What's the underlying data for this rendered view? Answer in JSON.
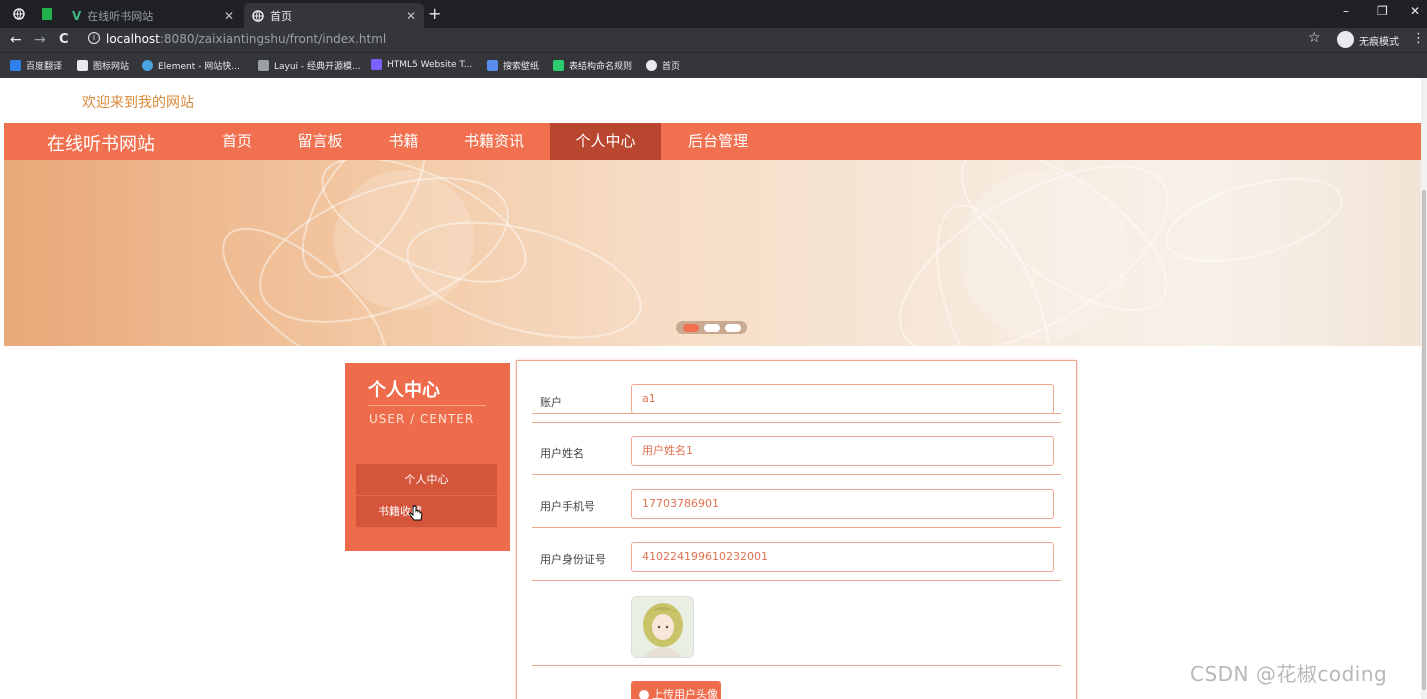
{
  "browser": {
    "tabs": [
      {
        "title": "在线听书网站",
        "active": false
      },
      {
        "title": "首页",
        "active": true
      }
    ],
    "new_tab": "+",
    "window_controls": {
      "minimize": "–",
      "restore": "❐",
      "close": "✕"
    },
    "nav": {
      "back": "←",
      "forward": "→",
      "reload": "C"
    },
    "url": {
      "host": "localhost",
      "path": ":8080/zaixiantingshu/front/index.html"
    },
    "incognito_label": "无痕模式",
    "bookmarks": [
      {
        "label": "百度翻译",
        "color": "#2f80ed"
      },
      {
        "label": "图标网站",
        "color": "#e8eaed"
      },
      {
        "label": "Element - 网站快...",
        "color": "#4aa3df"
      },
      {
        "label": "Layui - 经典开源模...",
        "color": "#9aa0a6"
      },
      {
        "label": "HTML5 Website T...",
        "color": "#7b61ff"
      },
      {
        "label": "搜索壁纸",
        "color": "#5b8def"
      },
      {
        "label": "表结构命名规则",
        "color": "#2ecc71"
      },
      {
        "label": "首页",
        "color": "#e8eaed"
      }
    ]
  },
  "site": {
    "welcome": "欢迎来到我的网站",
    "brand": "在线听书网站",
    "nav_items": [
      {
        "label": "首页",
        "active": false
      },
      {
        "label": "留言板",
        "active": false
      },
      {
        "label": "书籍",
        "active": false
      },
      {
        "label": "书籍资讯",
        "active": false
      },
      {
        "label": "个人中心",
        "active": true
      },
      {
        "label": "后台管理",
        "active": false
      }
    ],
    "banner": {
      "slides": 3,
      "active_slide": 1
    }
  },
  "sidebar": {
    "title": "个人中心",
    "subtitle": "USER / CENTER",
    "items": [
      {
        "label": "个人中心"
      },
      {
        "label": "书籍收藏"
      }
    ]
  },
  "form": {
    "fields": [
      {
        "label": "账户",
        "value": "a1"
      },
      {
        "label": "用户姓名",
        "value": "用户姓名1"
      },
      {
        "label": "用户手机号",
        "value": "17703786901"
      },
      {
        "label": "用户身份证号",
        "value": "410224199610232001"
      }
    ],
    "upload_label": "上传用户头像"
  },
  "watermark": "CSDN @花椒coding",
  "colors": {
    "primary": "#f1704f",
    "nav_active": "#b9462e",
    "welcome_text": "#d88a3a",
    "border": "#f1a690"
  }
}
